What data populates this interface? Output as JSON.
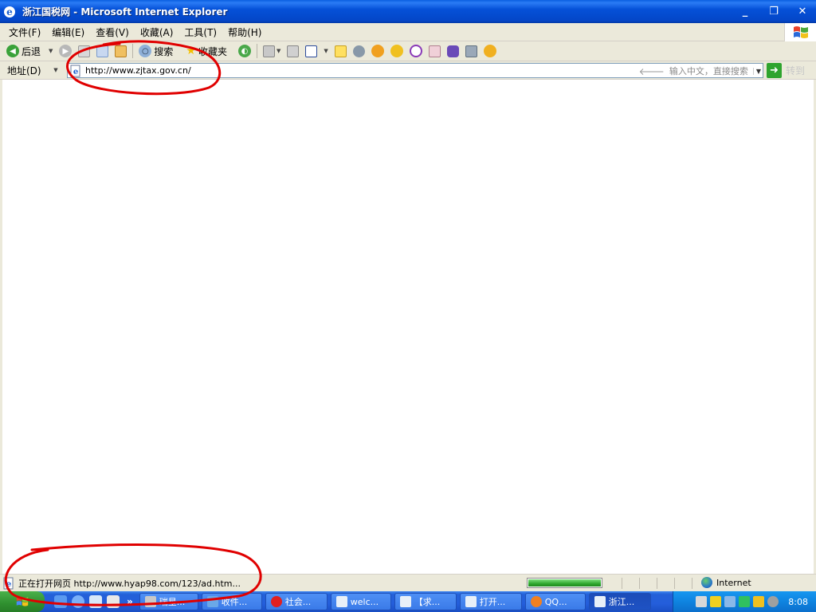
{
  "window": {
    "title": "浙江国税网 - Microsoft Internet Explorer",
    "minimize": "_",
    "restore": "❐",
    "close": "✕"
  },
  "menu": {
    "items": [
      "文件(F)",
      "编辑(E)",
      "查看(V)",
      "收藏(A)",
      "工具(T)",
      "帮助(H)"
    ]
  },
  "toolbar": {
    "back_label": "后退",
    "search_label": "搜索",
    "favorites_label": "收藏夹"
  },
  "address": {
    "label": "地址(D)",
    "url": "http://www.zjtax.gov.cn/",
    "search_placeholder": "输入中文，直接搜索",
    "go_label": "转到"
  },
  "status": {
    "text": "正在打开网页 http://www.hyap98.com/123/ad.htm...",
    "progress": 1.0,
    "zone": "Internet"
  },
  "taskbar": {
    "tasks": [
      {
        "label": "瑞星...",
        "active": false
      },
      {
        "label": "收件...",
        "active": false
      },
      {
        "label": "社会...",
        "active": false
      },
      {
        "label": "welc...",
        "active": false
      },
      {
        "label": "【求...",
        "active": false
      },
      {
        "label": "打开...",
        "active": false
      },
      {
        "label": "QQ...",
        "active": false
      },
      {
        "label": "浙江...",
        "active": true
      }
    ],
    "quicklaunch_more": "»",
    "clock": "8:08"
  },
  "colors": {
    "title_bar": "#0551d8",
    "chrome": "#ebe9da",
    "annotation": "#e00000",
    "progress": "#2fa82f"
  }
}
